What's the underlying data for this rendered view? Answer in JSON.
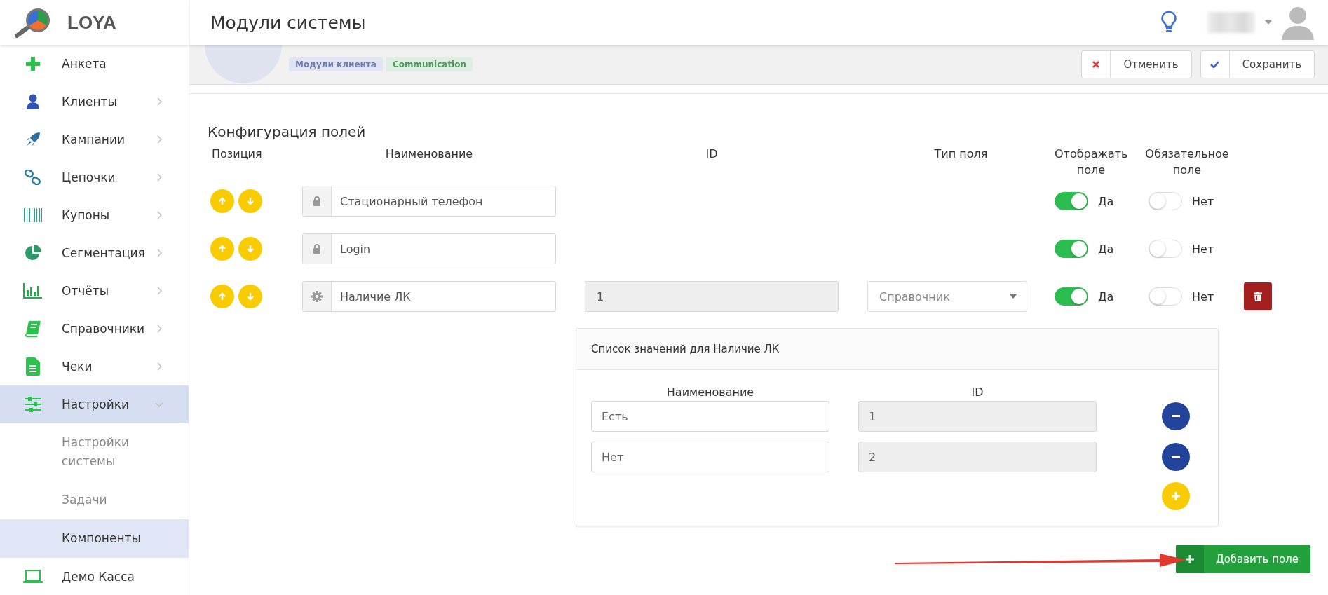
{
  "logo": {
    "text": "LOYA"
  },
  "header": {
    "title": "Модули системы"
  },
  "sidebar": {
    "items": [
      {
        "label": "Анкета",
        "expandable": false,
        "selected": false
      },
      {
        "label": "Клиенты",
        "expandable": true,
        "expanded": false,
        "selected": false
      },
      {
        "label": "Кампании",
        "expandable": true,
        "expanded": false,
        "selected": false
      },
      {
        "label": "Цепочки",
        "expandable": true,
        "expanded": false,
        "selected": false
      },
      {
        "label": "Купоны",
        "expandable": true,
        "expanded": false,
        "selected": false
      },
      {
        "label": "Сегментация",
        "expandable": true,
        "expanded": false,
        "selected": false
      },
      {
        "label": "Отчёты",
        "expandable": true,
        "expanded": false,
        "selected": false
      },
      {
        "label": "Справочники",
        "expandable": true,
        "expanded": false,
        "selected": false
      },
      {
        "label": "Чеки",
        "expandable": true,
        "expanded": false,
        "selected": false
      },
      {
        "label": "Настройки",
        "expandable": true,
        "expanded": true,
        "selected": true,
        "children": [
          {
            "label": "Настройки системы",
            "selected": false
          },
          {
            "label": "Задачи",
            "selected": false
          },
          {
            "label": "Компоненты",
            "selected": true
          }
        ]
      },
      {
        "label": "Демо Касса",
        "expandable": false,
        "selected": false
      }
    ]
  },
  "module": {
    "badges": [
      {
        "label": "Модули клиента",
        "color": "#dfe4f2"
      },
      {
        "label": "Communication",
        "color": "#dcefe0"
      }
    ]
  },
  "toolbar": {
    "cancel": "Отменить",
    "save": "Сохранить"
  },
  "section_title": "Конфигурация полей",
  "columns": [
    "Позиция",
    "Наименование",
    "ID",
    "Тип поля",
    "Отображать поле",
    "Обязательное поле"
  ],
  "fields": [
    {
      "kind": "system",
      "name": "Стационарный телефон",
      "visible": true,
      "visible_label": "Да",
      "required": false,
      "required_label": "Нет"
    },
    {
      "kind": "system",
      "name": "Login",
      "visible": true,
      "visible_label": "Да",
      "required": false,
      "required_label": "Нет"
    },
    {
      "kind": "custom",
      "name": "Наличие ЛК",
      "id": "1",
      "type": "Справочник",
      "visible": true,
      "visible_label": "Да",
      "required": false,
      "required_label": "Нет"
    }
  ],
  "values_panel": {
    "title": "Список значений для Наличие ЛК",
    "columns": [
      "Наименование",
      "ID"
    ],
    "rows": [
      {
        "name": "Есть",
        "id": "1"
      },
      {
        "name": "Нет",
        "id": "2"
      }
    ]
  },
  "add_button": "Добавить поле"
}
